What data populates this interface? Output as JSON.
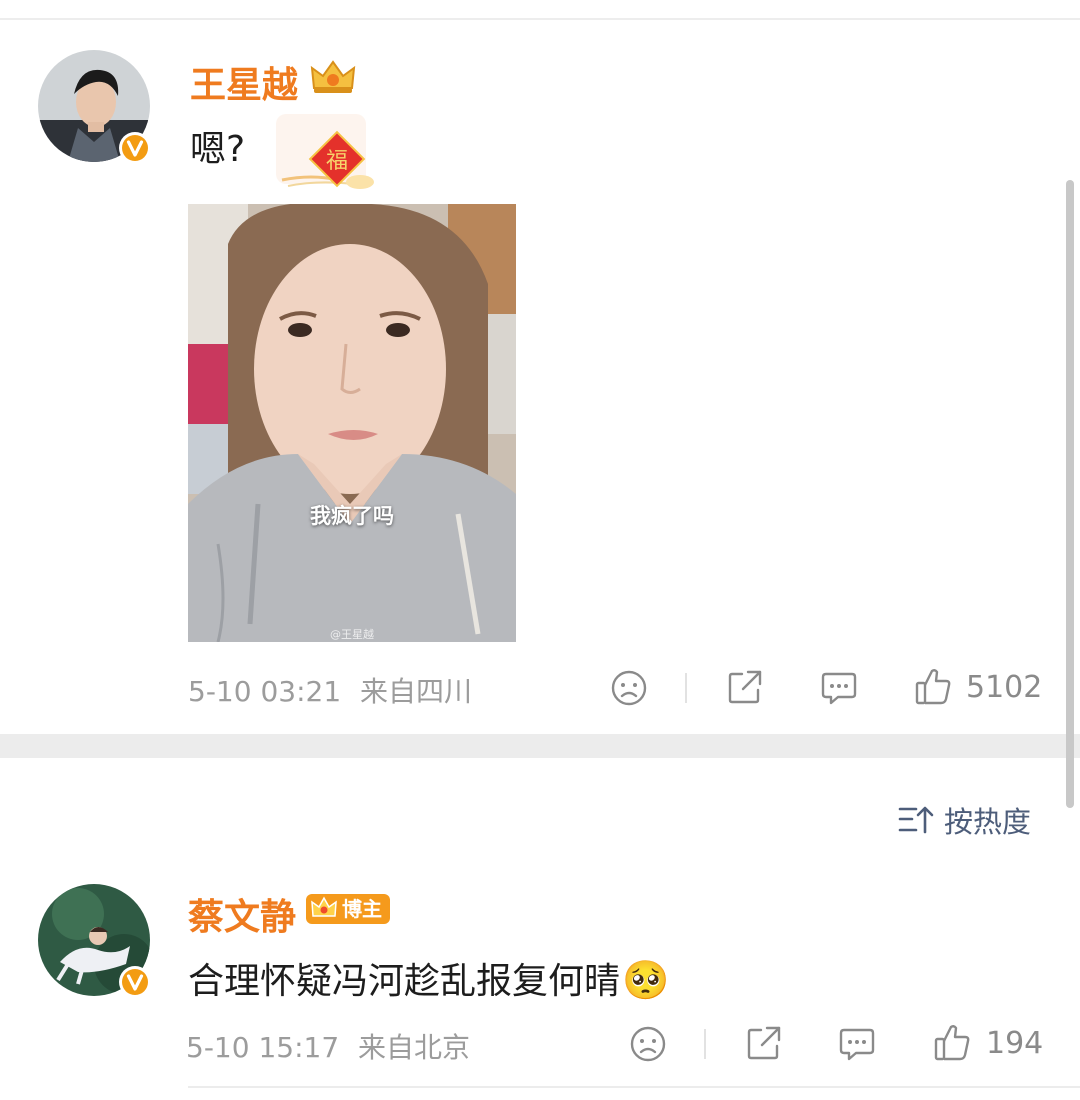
{
  "post": {
    "username": "王星越",
    "text": "嗯?",
    "image_caption": "我疯了吗",
    "image_watermark": "@王星越",
    "timestamp": "5-10 03:21",
    "location": "来自四川",
    "likes": "5102"
  },
  "sort": {
    "label": "按热度"
  },
  "comment": {
    "username": "蔡文静",
    "badge": "博主",
    "text": "合理怀疑冯河趁乱报复何晴",
    "emoji": "🥺",
    "timestamp": "5-10 15:17",
    "location": "来自北京",
    "likes": "194"
  },
  "icons": {
    "unlike": "sad-face-icon",
    "share": "share-icon",
    "comment": "comment-icon",
    "like": "thumbs-up-icon",
    "sort": "sort-icon",
    "verified": "verified-v-icon",
    "crown": "crown-icon",
    "fu": "fu-blessing-icon"
  },
  "colors": {
    "username": "#ef7b1f",
    "verified_badge": "#f39c12",
    "icon_gray": "#8a8a8a",
    "sort_text": "#4d5d7a"
  }
}
